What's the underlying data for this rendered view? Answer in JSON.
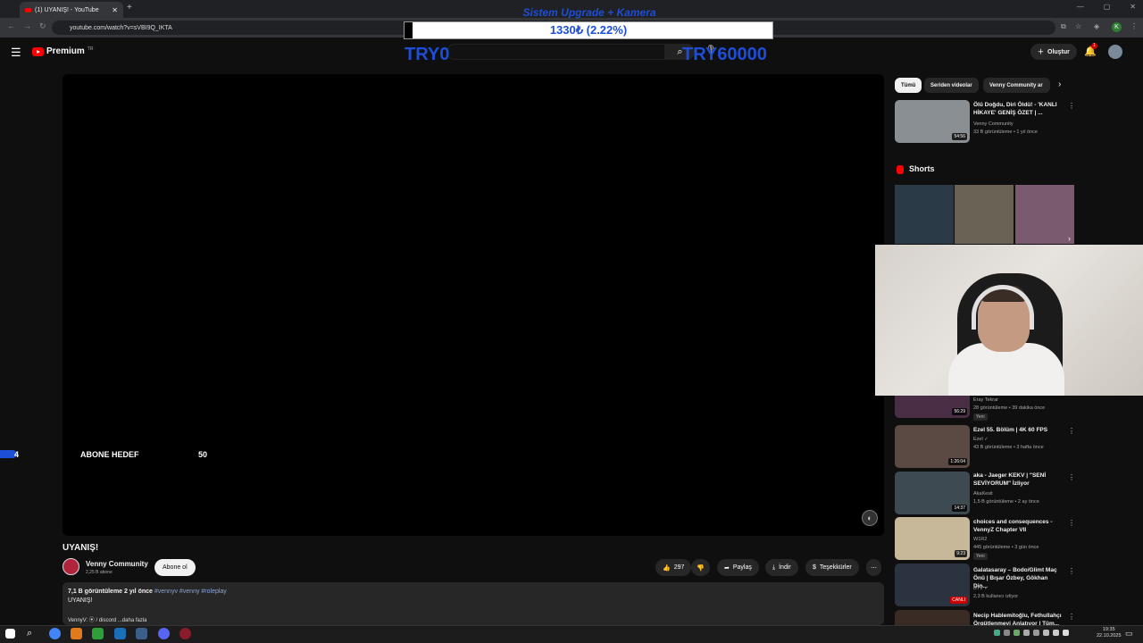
{
  "browser": {
    "tab_title": "(1) UYANIŞ! - YouTube",
    "new_tab": "+",
    "url": "youtube.com/watch?v=sVBI9Q_IKTA",
    "profile_initial": "K"
  },
  "overlay": {
    "title": "Sistem Upgrade + Kamera",
    "progress_text": "1330₺ (2.22%)",
    "progress_fraction": 0.0222,
    "current_amount": "TRY0",
    "goal_amount": "TRY60000"
  },
  "header": {
    "logo_text": "Premium",
    "logo_region": "TR",
    "create_label": "Oluştur",
    "notif_count": "1"
  },
  "subscriber_goal": {
    "current": "4",
    "label": "ABONE HEDEF",
    "target": "50"
  },
  "video": {
    "title": "UYANIŞ!",
    "channel": "Venny Community",
    "subscribers": "2,25 B abone",
    "subscribe_label": "Abone ol",
    "likes": "297",
    "share_label": "Paylaş",
    "download_label": "İndir",
    "thanks_label": "Teşekkürler",
    "description": {
      "meta": "7,1 B görüntüleme  2 yıl önce",
      "tags": " #vennyv #venny #roleplay",
      "title": "UYANIŞ!",
      "footer": "VennyV: ⦿ / discord  ...daha fazla"
    }
  },
  "chips": [
    "Tümü",
    "Seriden videolar",
    "Venny Community ar"
  ],
  "related": [
    {
      "title": "Ölü Doğdu, Diri Öldü! - 'KANLI HİKAYE' GENİŞ ÖZET | ...",
      "channel": "Venny Community",
      "meta": "33 B görüntüleme • 1 yıl önce",
      "duration": "54:56",
      "thumb": "#8a8f94"
    },
    {
      "title": "",
      "channel": "Eray Tekrar",
      "meta": "28 görüntüleme • 39 dakika önce",
      "duration": "56:29",
      "badge": "Yeni",
      "thumb": "#4a2e46"
    },
    {
      "title": "Ezel 55. Bölüm | 4K 60 FPS",
      "channel": "Ezel ✓",
      "meta": "43 B görüntüleme • 3 hafta önce",
      "duration": "1:26:04",
      "thumb": "#5b4a44"
    },
    {
      "title": "aka - Jaeger KEKV | \"SENİ SEVİYORUM\" İzliyor",
      "channel": "AkaKesit",
      "meta": "1,5 B görüntüleme • 2 ay önce",
      "duration": "14:37",
      "thumb": "#3e4a52"
    },
    {
      "title": "choices and consequences - VennyZ Chapter VII",
      "channel": "W1R2",
      "meta": "445 görüntüleme • 3 gün önce",
      "duration": "9:23",
      "badge": "Yeni",
      "thumb": "#c8b89a"
    },
    {
      "title": "Galatasaray – Bodo/Glimt Maç Önü | Bışar Özbey, Gökhan Din...",
      "channel": "BTV ✓",
      "meta": "2,3 B kullanıcı izliyor",
      "duration": "CANLI",
      "thumb": "#2b3340"
    },
    {
      "title": "Necip Hablemitoğlu, Fethullahçı Örgütlenmeyi Anlatıyor | Tüm...",
      "channel": "",
      "meta": "",
      "duration": "",
      "thumb": "#3a2b24"
    }
  ],
  "shorts": {
    "label": "Shorts",
    "items": [
      {
        "color": "#2a3a46"
      },
      {
        "color": "#6b6256"
      },
      {
        "color": "#7a5a6e"
      }
    ]
  },
  "taskbar": {
    "time": "19:35",
    "date": "22.10.2025"
  },
  "colors": {
    "overlay_blue": "#1d4ed8",
    "youtube_red": "#ff0000"
  }
}
